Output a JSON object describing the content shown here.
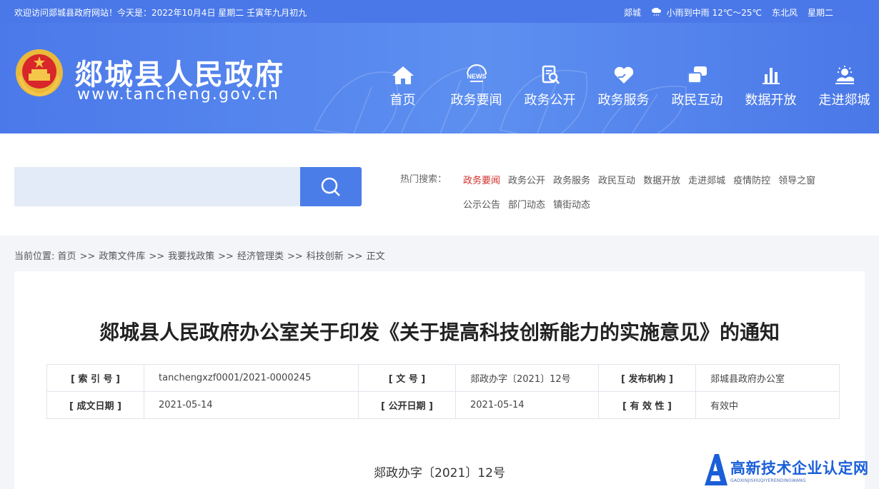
{
  "topbar": {
    "welcome": "欢迎访问郯城县政府网站！今天是：2022年10月4日  星期二  壬寅年九月初九",
    "city": "郯城",
    "weather": "小雨到中雨 12℃～25℃",
    "wind": "东北风",
    "weekday": "星期二"
  },
  "header": {
    "title": "郯城县人民政府",
    "url": "www.tancheng.gov.cn",
    "nav": [
      {
        "label": "首页",
        "icon": "home-icon"
      },
      {
        "label": "政务要闻",
        "icon": "news-icon"
      },
      {
        "label": "政务公开",
        "icon": "document-search-icon"
      },
      {
        "label": "政务服务",
        "icon": "heart-hand-icon"
      },
      {
        "label": "政民互动",
        "icon": "chat-icon"
      },
      {
        "label": "数据开放",
        "icon": "bar-chart-icon"
      },
      {
        "label": "走进郯城",
        "icon": "sun-cloud-icon"
      }
    ]
  },
  "search": {
    "placeholder": "",
    "hot_label": "热门搜索：",
    "hot_links": [
      "政务要闻",
      "政务公开",
      "政务服务",
      "政民互动",
      "数据开放",
      "走进郯城",
      "疫情防控",
      "领导之窗",
      "公示公告",
      "部门动态",
      "镇街动态"
    ]
  },
  "breadcrumb": {
    "prefix": "当前位置: ",
    "items": [
      "首页",
      "政策文件库",
      "我要找政策",
      "经济管理类",
      "科技创新",
      "正文"
    ],
    "sep": ">>"
  },
  "article": {
    "title": "郯城县人民政府办公室关于印发《关于提高科技创新能力的实施意见》的通知",
    "meta": [
      [
        {
          "key": "[ 索 引 号 ]",
          "value": "tanchengxzf0001/2021-0000245"
        },
        {
          "key": "[ 文      号 ]",
          "value": "郯政办字〔2021〕12号"
        },
        {
          "key": "[ 发布机构 ]",
          "value": "郯城县政府办公室"
        }
      ],
      [
        {
          "key": "[ 成文日期 ]",
          "value": "2021-05-14"
        },
        {
          "key": "[ 公开日期 ]",
          "value": "2021-05-14"
        },
        {
          "key": "[ 有 效 性 ]",
          "value": "有效中"
        }
      ]
    ],
    "doc_number": "郯政办字〔2021〕12号"
  },
  "watermark": {
    "cn": "高新技术企业认定网",
    "en": "GAOXINJISHUQIYERENDINGWANG"
  },
  "colors": {
    "primary": "#4a78e8",
    "active_link": "#d0302a",
    "search_bg": "#e3ebf8"
  }
}
